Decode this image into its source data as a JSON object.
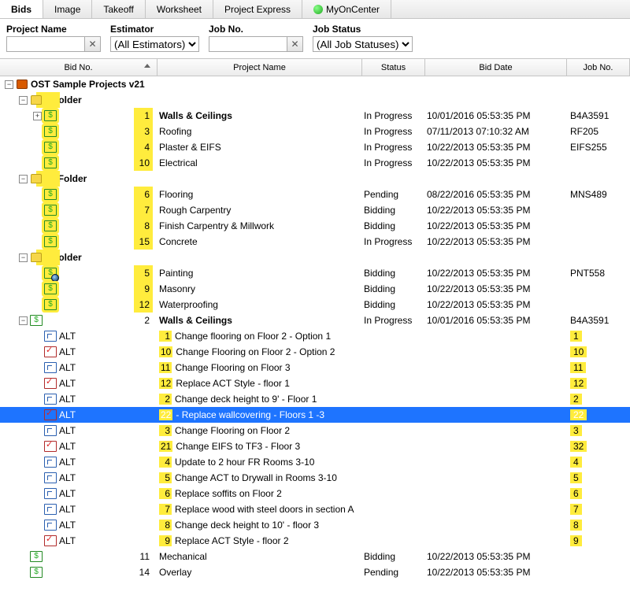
{
  "tabs": [
    "Bids",
    "Image",
    "Takeoff",
    "Worksheet",
    "Project Express",
    "MyOnCenter"
  ],
  "activeTab": 0,
  "filters": {
    "projectName": {
      "label": "Project Name",
      "value": ""
    },
    "estimator": {
      "label": "Estimator",
      "selected": "(All Estimators)"
    },
    "jobNo": {
      "label": "Job No.",
      "value": ""
    },
    "jobStatus": {
      "label": "Job Status",
      "selected": "(All Job Statuses)"
    }
  },
  "columns": {
    "bidNo": "Bid No.",
    "project": "Project Name",
    "status": "Status",
    "date": "Bid Date",
    "job": "Job No."
  },
  "rootLabel": "OST Sample Projects v21",
  "rows": [
    {
      "t": "root",
      "expand": "-",
      "icon": "db",
      "label": "OST Sample Projects v21"
    },
    {
      "t": "folder",
      "expand": "-",
      "depth": 1,
      "label": "1 Folder",
      "hlBand": true
    },
    {
      "t": "bid",
      "expand": "+",
      "depth": 2,
      "hlIcon": true,
      "num": "1",
      "hlNum": true,
      "name": "Walls & Ceilings",
      "bold": true,
      "status": "In Progress",
      "date": "10/01/2016 05:53:35 PM",
      "job": "B4A3591"
    },
    {
      "t": "bid",
      "depth": 2,
      "hlIcon": true,
      "num": "3",
      "hlNum": true,
      "name": "Roofing",
      "status": "In Progress",
      "date": "07/11/2013 07:10:32 AM",
      "job": "RF205"
    },
    {
      "t": "bid",
      "depth": 2,
      "hlIcon": true,
      "num": "4",
      "hlNum": true,
      "name": "Plaster & EIFS",
      "status": "In Progress",
      "date": "10/22/2013 05:53:35 PM",
      "job": "EIFS255"
    },
    {
      "t": "bid",
      "depth": 2,
      "hlIcon": true,
      "num": "10",
      "hlNum": true,
      "name": "Electrical",
      "status": "In Progress",
      "date": "10/22/2013 05:53:35 PM"
    },
    {
      "t": "folder",
      "expand": "-",
      "depth": 1,
      "label": "10 Folder",
      "hlBand": true
    },
    {
      "t": "bid",
      "depth": 2,
      "hlIcon": true,
      "num": "6",
      "hlNum": true,
      "name": "Flooring",
      "status": "Pending",
      "date": "08/22/2016 05:53:35 PM",
      "job": "MNS489"
    },
    {
      "t": "bid",
      "depth": 2,
      "hlIcon": true,
      "num": "7",
      "hlNum": true,
      "name": "Rough Carpentry",
      "status": "Bidding",
      "date": "10/22/2013 05:53:35 PM"
    },
    {
      "t": "bid",
      "depth": 2,
      "hlIcon": true,
      "num": "8",
      "hlNum": true,
      "name": "Finish Carpentry & Millwork",
      "status": "Bidding",
      "date": "10/22/2013 05:53:35 PM"
    },
    {
      "t": "bid",
      "depth": 2,
      "hlIcon": true,
      "num": "15",
      "hlNum": true,
      "name": "Concrete",
      "status": "In Progress",
      "date": "10/22/2013 05:53:35 PM"
    },
    {
      "t": "folder",
      "expand": "-",
      "depth": 1,
      "label": "2 Folder",
      "hlBand": true
    },
    {
      "t": "bid",
      "depth": 2,
      "hlIcon": true,
      "badge": true,
      "num": "5",
      "hlNum": true,
      "name": "Painting",
      "status": "Bidding",
      "date": "10/22/2013 05:53:35 PM",
      "job": "PNT558"
    },
    {
      "t": "bid",
      "depth": 2,
      "hlIcon": true,
      "num": "9",
      "hlNum": true,
      "name": "Masonry",
      "status": "Bidding",
      "date": "10/22/2013 05:53:35 PM"
    },
    {
      "t": "bid",
      "depth": 2,
      "hlIcon": true,
      "num": "12",
      "hlNum": true,
      "name": "Waterproofing",
      "status": "Bidding",
      "date": "10/22/2013 05:53:35 PM"
    },
    {
      "t": "bid",
      "expand": "-",
      "depth": 1,
      "num": "2",
      "name": "Walls & Ceilings",
      "bold": true,
      "status": "In Progress",
      "date": "10/01/2016 05:53:35 PM",
      "job": "B4A3591"
    },
    {
      "t": "alt",
      "depth": 2,
      "chk": false,
      "altLabel": "ALT",
      "pn": "1",
      "hlPn": true,
      "name": "Change flooring on Floor 2 - Option 1",
      "job": "1",
      "hlJob": true
    },
    {
      "t": "alt",
      "depth": 2,
      "chk": true,
      "altLabel": "ALT",
      "pn": "10",
      "hlPn": true,
      "name": "Change Flooring on Floor 2 - Option 2",
      "job": "10",
      "hlJob": true
    },
    {
      "t": "alt",
      "depth": 2,
      "chk": false,
      "altLabel": "ALT",
      "pn": "11",
      "hlPn": true,
      "name": "Change Flooring on Floor 3",
      "job": "11",
      "hlJob": true
    },
    {
      "t": "alt",
      "depth": 2,
      "chk": true,
      "altLabel": "ALT",
      "pn": "12",
      "hlPn": true,
      "name": "Replace ACT Style - floor 1",
      "job": "12",
      "hlJob": true
    },
    {
      "t": "alt",
      "depth": 2,
      "chk": false,
      "altLabel": "ALT",
      "pn": "2",
      "hlPn": true,
      "name": "Change deck height to 9' - Floor 1",
      "job": "2",
      "hlJob": true
    },
    {
      "t": "alt",
      "depth": 2,
      "chk": true,
      "altLabel": "ALT",
      "pn": "22",
      "hlPn": true,
      "name": "- Replace wallcovering - Floors 1 -3",
      "job": "22",
      "hlJob": true,
      "selected": true
    },
    {
      "t": "alt",
      "depth": 2,
      "chk": false,
      "altLabel": "ALT",
      "pn": "3",
      "hlPn": true,
      "name": "Change Flooring on Floor 2",
      "job": "3",
      "hlJob": true
    },
    {
      "t": "alt",
      "depth": 2,
      "chk": true,
      "altLabel": "ALT",
      "pn": "21",
      "hlPn": true,
      "name": "Change EIFS to TF3 - Floor 3",
      "job": "32",
      "hlJob": true
    },
    {
      "t": "alt",
      "depth": 2,
      "chk": false,
      "altLabel": "ALT",
      "pn": "4",
      "hlPn": true,
      "name": "Update to 2 hour FR Rooms 3-10",
      "job": "4",
      "hlJob": true
    },
    {
      "t": "alt",
      "depth": 2,
      "chk": false,
      "altLabel": "ALT",
      "pn": "5",
      "hlPn": true,
      "name": "Change ACT to Drywall in Rooms 3-10",
      "job": "5",
      "hlJob": true
    },
    {
      "t": "alt",
      "depth": 2,
      "chk": false,
      "altLabel": "ALT",
      "pn": "6",
      "hlPn": true,
      "name": "Replace soffits on Floor 2",
      "job": "6",
      "hlJob": true
    },
    {
      "t": "alt",
      "depth": 2,
      "chk": false,
      "altLabel": "ALT",
      "pn": "7",
      "hlPn": true,
      "name": "Replace wood with steel doors in section A",
      "job": "7",
      "hlJob": true
    },
    {
      "t": "alt",
      "depth": 2,
      "chk": false,
      "altLabel": "ALT",
      "pn": "8",
      "hlPn": true,
      "name": "Change deck height to 10' - floor 3",
      "job": "8",
      "hlJob": true
    },
    {
      "t": "alt",
      "depth": 2,
      "chk": true,
      "altLabel": "ALT",
      "pn": "9",
      "hlPn": true,
      "name": "Replace ACT Style - floor 2",
      "job": "9",
      "hlJob": true
    },
    {
      "t": "bid",
      "depth": 1,
      "num": "11",
      "name": "Mechanical",
      "status": "Bidding",
      "date": "10/22/2013 05:53:35 PM"
    },
    {
      "t": "bid",
      "depth": 1,
      "num": "14",
      "name": "Overlay",
      "status": "Pending",
      "date": "10/22/2013 05:53:35 PM"
    }
  ]
}
